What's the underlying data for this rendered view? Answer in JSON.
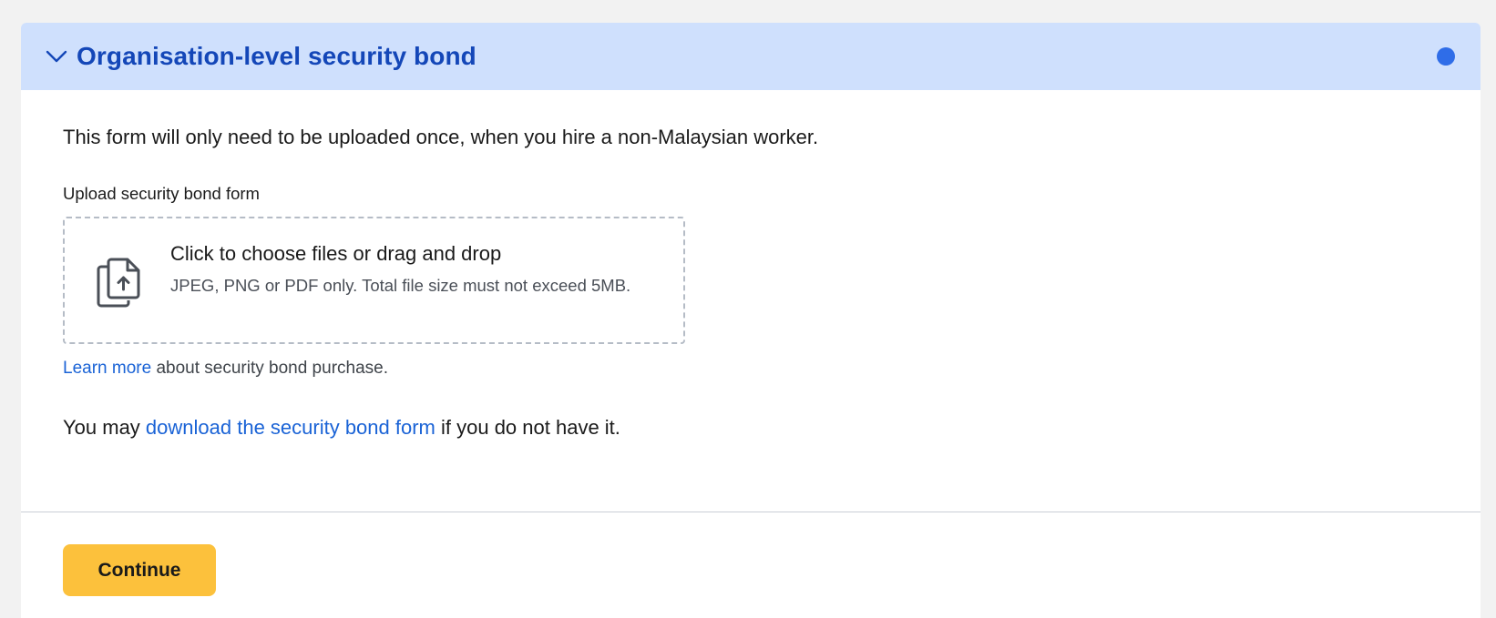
{
  "section": {
    "title": "Organisation-level security bond",
    "status_color": "#2f6de8",
    "expanded": true
  },
  "intro_text": "This form will only need to be uploaded once, when you hire a non-Malaysian worker.",
  "upload": {
    "label": "Upload security bond form",
    "dropzone_title": "Click to choose files or drag and drop",
    "dropzone_hint": "JPEG, PNG or PDF only. Total file size must not exceed 5MB.",
    "icon": "file-upload-icon"
  },
  "learn_more": {
    "link_text": "Learn more",
    "suffix": " about security bond purchase."
  },
  "download": {
    "prefix": "You may ",
    "link_text": "download the security bond form",
    "suffix": " if you do not have it."
  },
  "actions": {
    "continue_label": "Continue"
  },
  "colors": {
    "header_bg": "#cfe0fd",
    "title": "#1447b8",
    "link": "#1a63d6",
    "button": "#fcc13c"
  }
}
